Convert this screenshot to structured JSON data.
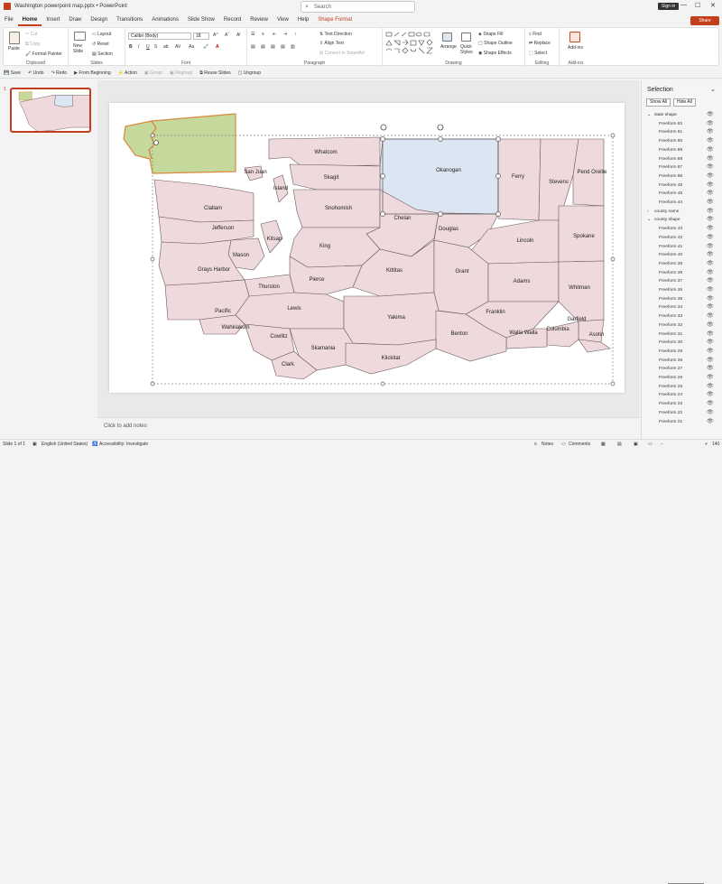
{
  "titlebar": {
    "doc_title": "Washington powerpoint map.pptx  •  PowerPoint",
    "search_placeholder": "Search",
    "signin": "Sign in",
    "minimize": "—",
    "maximize": "☐",
    "close": "✕"
  },
  "menu": {
    "tabs": [
      "File",
      "Home",
      "Insert",
      "Draw",
      "Design",
      "Transitions",
      "Animations",
      "Slide Show",
      "Record",
      "Review",
      "View",
      "Help",
      "Shape Format"
    ],
    "active": "Home",
    "share": "Share"
  },
  "ribbon": {
    "clipboard": {
      "label": "Clipboard",
      "paste": "Paste",
      "cut": "Cut",
      "copy": "Copy",
      "format_painter": "Format Painter"
    },
    "slides": {
      "label": "Slides",
      "new_slide": "New Slide",
      "layout": "Layout",
      "reset": "Reset",
      "section": "Section"
    },
    "font": {
      "label": "Font",
      "font_name": "Calibri (Body)",
      "font_size": "18"
    },
    "paragraph": {
      "label": "Paragraph",
      "text_direction": "Text Direction",
      "align_text": "Align Text",
      "convert_smartart": "Convert to SmartArt"
    },
    "drawing": {
      "label": "Drawing",
      "arrange": "Arrange",
      "quick_styles": "Quick Styles",
      "shape_fill": "Shape Fill",
      "shape_outline": "Shape Outline",
      "shape_effects": "Shape Effects"
    },
    "editing": {
      "label": "Editing",
      "find": "Find",
      "replace": "Replace",
      "select": "Select"
    },
    "addins": {
      "label": "Add-ins",
      "addins_btn": "Add-ins"
    }
  },
  "qat": {
    "save": "Save",
    "undo": "Undo",
    "redo": "Redo",
    "from_beginning": "From Beginning",
    "action": "Action",
    "group": "Group",
    "regroup": "Regroup",
    "reuse": "Reuse Slides",
    "ungroup": "Ungroup"
  },
  "slides_panel": {
    "slide_number": "1"
  },
  "map": {
    "counties": [
      "Whatcom",
      "San Juan",
      "Okanogan",
      "Ferry",
      "Stevens",
      "Pend Oreille",
      "Skagit",
      "Island",
      "Snohomish",
      "Clallam",
      "Chelan",
      "Jefferson",
      "Douglas",
      "Lincoln",
      "Spokane",
      "Kitsap",
      "Mason",
      "King",
      "Grays Harbor",
      "Kittitas",
      "Grant",
      "Thurston",
      "Pierce",
      "Adams",
      "Whitman",
      "Pacific",
      "Lewis",
      "Franklin",
      "Garfield",
      "Yakima",
      "Wahkiakum",
      "Walla Walla",
      "Columbia",
      "Cowlitz",
      "Benton",
      "Asotin",
      "Skamania",
      "Klickitat",
      "Clark"
    ],
    "colors": {
      "county_fill": "#eed9dc",
      "county_stroke": "#6e5a5e",
      "selected_fill": "#dce5f2",
      "state_fill": "#c5d99c",
      "accent": "#c43e1c"
    }
  },
  "notes": {
    "placeholder": "Click to add notes"
  },
  "selection_pane": {
    "title": "Selection",
    "show_all": "Show All",
    "hide_all": "Hide All",
    "groups": [
      {
        "name": "state shape",
        "items": [
          "Freeform 92",
          "Freeform 91",
          "Freeform 90",
          "Freeform 89",
          "Freeform 88",
          "Freeform 87",
          "Freeform 86",
          "Freeform 46",
          "Freeform 45",
          "Freeform 44"
        ]
      },
      {
        "name": "county name",
        "items": []
      },
      {
        "name": "county shape",
        "items": [
          "Freeform 43",
          "Freeform 42",
          "Freeform 41",
          "Freeform 40",
          "Freeform 39",
          "Freeform 38",
          "Freeform 37",
          "Freeform 36",
          "Freeform 35",
          "Freeform 34",
          "Freeform 33",
          "Freeform 32",
          "Freeform 31",
          "Freeform 30",
          "Freeform 29",
          "Freeform 28",
          "Freeform 27",
          "Freeform 26",
          "Freeform 25",
          "Freeform 24",
          "Freeform 23",
          "Freeform 22",
          "Freeform 21"
        ]
      }
    ]
  },
  "status": {
    "slide": "Slide 1 of 1",
    "language": "English (United States)",
    "accessibility": "Accessibility: Investigate",
    "notes": "Notes",
    "comments": "Comments",
    "zoom": "140"
  }
}
